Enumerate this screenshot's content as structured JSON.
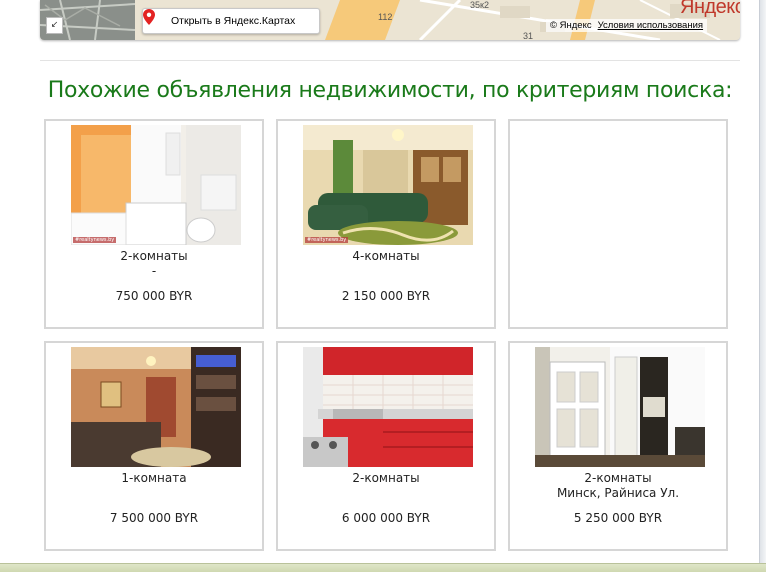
{
  "map": {
    "open_label": "Открыть в Яндекс.Картах",
    "collapse_glyph": "↙",
    "logo": "Яндекс",
    "copyright": "© Яндекс",
    "terms": "Условия использования",
    "labels": [
      "112",
      "35к2",
      "31"
    ]
  },
  "heading": "Похожие объявления недвижимости, по критериям поиска:",
  "listings": [
    {
      "rooms": "2-комнаты",
      "address": "-",
      "price": "750 000 BYR",
      "watermark": "#realtynews.by"
    },
    {
      "rooms": "4-комнаты",
      "address": "",
      "price": "2 150 000 BYR",
      "watermark": "#realtynews.by"
    },
    {
      "rooms": "",
      "address": "",
      "price": "",
      "watermark": ""
    },
    {
      "rooms": "1-комната",
      "address": "",
      "price": "7 500 000 BYR",
      "watermark": ""
    },
    {
      "rooms": "2-комнаты",
      "address": "",
      "price": "6 000 000 BYR",
      "watermark": ""
    },
    {
      "rooms": "2-комнаты",
      "address": "Минск, Райниса Ул.",
      "price": "5 250 000 BYR",
      "watermark": ""
    }
  ],
  "colors": {
    "heading": "#1a7a1a",
    "card_border": "#d6d6d6",
    "map_logo": "#c0392b"
  },
  "icons": [
    "map-pin-icon",
    "collapse-arrow-icon"
  ]
}
